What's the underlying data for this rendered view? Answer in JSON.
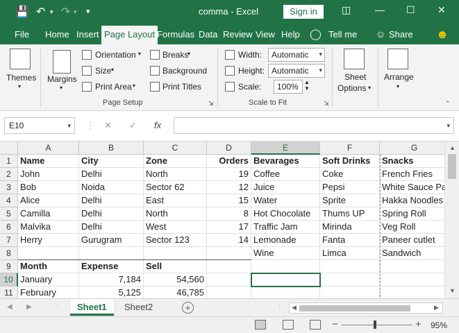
{
  "app": {
    "title": "comma  -  Excel",
    "sign_in": "Sign in",
    "brand_color": "#217346"
  },
  "tabs": [
    "File",
    "Home",
    "Insert",
    "Page Layout",
    "Formulas",
    "Data",
    "Review",
    "View",
    "Help"
  ],
  "tab_active": "Page Layout",
  "tell_me": "Tell me",
  "share": "Share",
  "ribbon": {
    "themes": "Themes",
    "margins": "Margins",
    "orientation": "Orientation",
    "size": "Size",
    "print_area": "Print Area",
    "breaks": "Breaks",
    "background": "Background",
    "print_titles": "Print Titles",
    "page_setup": "Page Setup",
    "width_label": "Width:",
    "width_value": "Automatic",
    "height_label": "Height:",
    "height_value": "Automatic",
    "scale_label": "Scale:",
    "scale_value": "100%",
    "scale_to_fit": "Scale to Fit",
    "sheet_options_1": "Sheet",
    "sheet_options_2": "Options",
    "arrange": "Arrange"
  },
  "formula_bar": {
    "name_box": "E10",
    "fx": "fx",
    "value": ""
  },
  "columns": [
    "A",
    "B",
    "C",
    "D",
    "E",
    "F",
    "G"
  ],
  "selected_column": "E",
  "rows": [
    "1",
    "2",
    "3",
    "4",
    "5",
    "6",
    "7",
    "8",
    "9",
    "10",
    "11"
  ],
  "selected_row": "10",
  "cells": {
    "r1": [
      "Name",
      "City",
      "Zone",
      "Orders",
      "Bevarages",
      "Soft Drinks",
      "Snacks"
    ],
    "r2": [
      "John",
      "Delhi",
      "North",
      "19",
      "Coffee",
      "Coke",
      "French Fries"
    ],
    "r3": [
      "Bob",
      "Noida",
      "Sector 62",
      "12",
      "Juice",
      "Pepsi",
      "White Sauce Pasta"
    ],
    "r4": [
      "Alice",
      "Delhi",
      "East",
      "15",
      "Water",
      "Sprite",
      "Hakka Noodles"
    ],
    "r5": [
      "Camilla",
      "Delhi",
      "North",
      "8",
      "Hot Chocolate",
      "Thums UP",
      "Spring Roll"
    ],
    "r6": [
      "Malvika",
      "Delhi",
      "West",
      "17",
      "Traffic Jam",
      "Mirinda",
      "Veg Roll"
    ],
    "r7": [
      "Herry",
      "Gurugram",
      "Sector 123",
      "14",
      "Lemonade",
      "Fanta",
      "Paneer cutlet"
    ],
    "r8": [
      "",
      "",
      "",
      "",
      "Wine",
      "Limca",
      "Sandwich"
    ],
    "r9": [
      "Month",
      "Expense",
      "Sell",
      "",
      "",
      "",
      ""
    ],
    "r10": [
      "January",
      "7,184",
      "54,560",
      "",
      "",
      "",
      ""
    ],
    "r11": [
      "February",
      "5,125",
      "46,785",
      "",
      "",
      "",
      ""
    ]
  },
  "sheets": [
    "Sheet1",
    "Sheet2"
  ],
  "active_sheet": "Sheet1",
  "status": {
    "zoom": "95%"
  }
}
